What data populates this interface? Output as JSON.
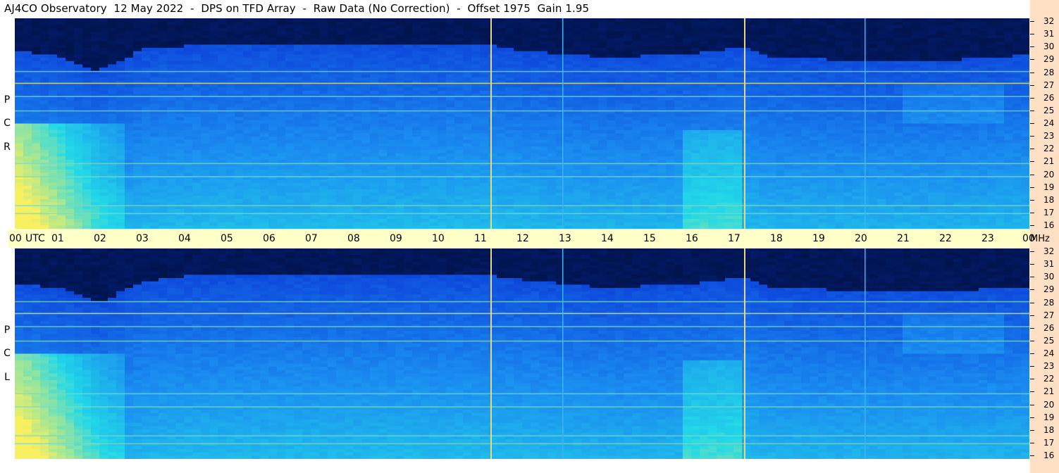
{
  "title": "AJ4CO Observatory  12 May 2022  -  DPS on TFD Array  -  Raw Data (No Correction)  -  Offset 1975  Gain 1.95",
  "chart_data": [
    {
      "type": "heatmap",
      "panel": "RCP",
      "side_label": [
        "R",
        "C",
        "P"
      ],
      "x": {
        "unit_label": "UTC",
        "ticks": [
          "00",
          "01",
          "02",
          "03",
          "04",
          "05",
          "06",
          "07",
          "08",
          "09",
          "10",
          "11",
          "12",
          "13",
          "14",
          "15",
          "16",
          "17",
          "18",
          "19",
          "20",
          "21",
          "22",
          "23",
          "00"
        ],
        "range_hours": [
          0,
          24
        ]
      },
      "y": {
        "unit_label": "MHz",
        "ticks": [
          "32",
          "31",
          "30",
          "29",
          "28",
          "27",
          "26",
          "25",
          "24",
          "23",
          "22",
          "21",
          "20",
          "19",
          "18",
          "17",
          "16"
        ],
        "range_mhz": [
          16,
          32
        ]
      },
      "intensity_levels": [
        0.0,
        0.25,
        0.5,
        0.75,
        1.0
      ],
      "low_band_upper_mhz": {
        "hours": [
          0,
          1,
          2,
          3,
          4,
          8,
          11.2,
          12,
          14,
          16,
          17.2,
          18,
          20,
          22,
          24
        ],
        "mhz": [
          29.5,
          29.2,
          28.0,
          29.6,
          29.9,
          30.0,
          30.0,
          29.5,
          29.0,
          29.3,
          29.8,
          29.0,
          28.8,
          28.8,
          29.2
        ]
      },
      "interference_lines_mhz": [
        17.2,
        17.8,
        20.0,
        21.0,
        25.0,
        26.1,
        27.1,
        28.0
      ],
      "vertical_markers_hours": [
        11.25,
        12.95,
        17.25,
        20.1
      ]
    },
    {
      "type": "heatmap",
      "panel": "LCP",
      "side_label": [
        "L",
        "C",
        "P"
      ],
      "x": {
        "unit_label": "UTC",
        "ticks": [
          "00",
          "01",
          "02",
          "03",
          "04",
          "05",
          "06",
          "07",
          "08",
          "09",
          "10",
          "11",
          "12",
          "13",
          "14",
          "15",
          "16",
          "17",
          "18",
          "19",
          "20",
          "21",
          "22",
          "23",
          "00"
        ],
        "range_hours": [
          0,
          24
        ]
      },
      "y": {
        "unit_label": "MHz",
        "ticks": [
          "32",
          "31",
          "30",
          "29",
          "28",
          "27",
          "26",
          "25",
          "24",
          "23",
          "22",
          "21",
          "20",
          "19",
          "18",
          "17",
          "16"
        ],
        "range_mhz": [
          16,
          32
        ]
      },
      "intensity_levels": [
        0.0,
        0.25,
        0.5,
        0.75,
        1.0
      ],
      "low_band_upper_mhz": {
        "hours": [
          0,
          1,
          2,
          3,
          4,
          8,
          11.2,
          12,
          14,
          16,
          17.2,
          18,
          20,
          22,
          24
        ],
        "mhz": [
          29.3,
          29.0,
          27.8,
          29.5,
          29.9,
          30.0,
          30.0,
          29.6,
          29.0,
          29.3,
          29.8,
          29.0,
          28.8,
          28.8,
          29.0
        ]
      },
      "interference_lines_mhz": [
        17.2,
        17.8,
        20.0,
        21.0,
        25.0,
        26.1,
        27.1,
        28.0
      ],
      "vertical_markers_hours": [
        11.25,
        12.95,
        17.25,
        20.1
      ]
    }
  ],
  "colors": {
    "background": "#ffffff",
    "time_bar": "#ffffc8",
    "freq_column": "#ffe0c4",
    "plot_bg": "#000000",
    "colormap": [
      "#001040",
      "#0b3bd8",
      "#1a8cf0",
      "#22d8e8",
      "#f8f060"
    ]
  }
}
